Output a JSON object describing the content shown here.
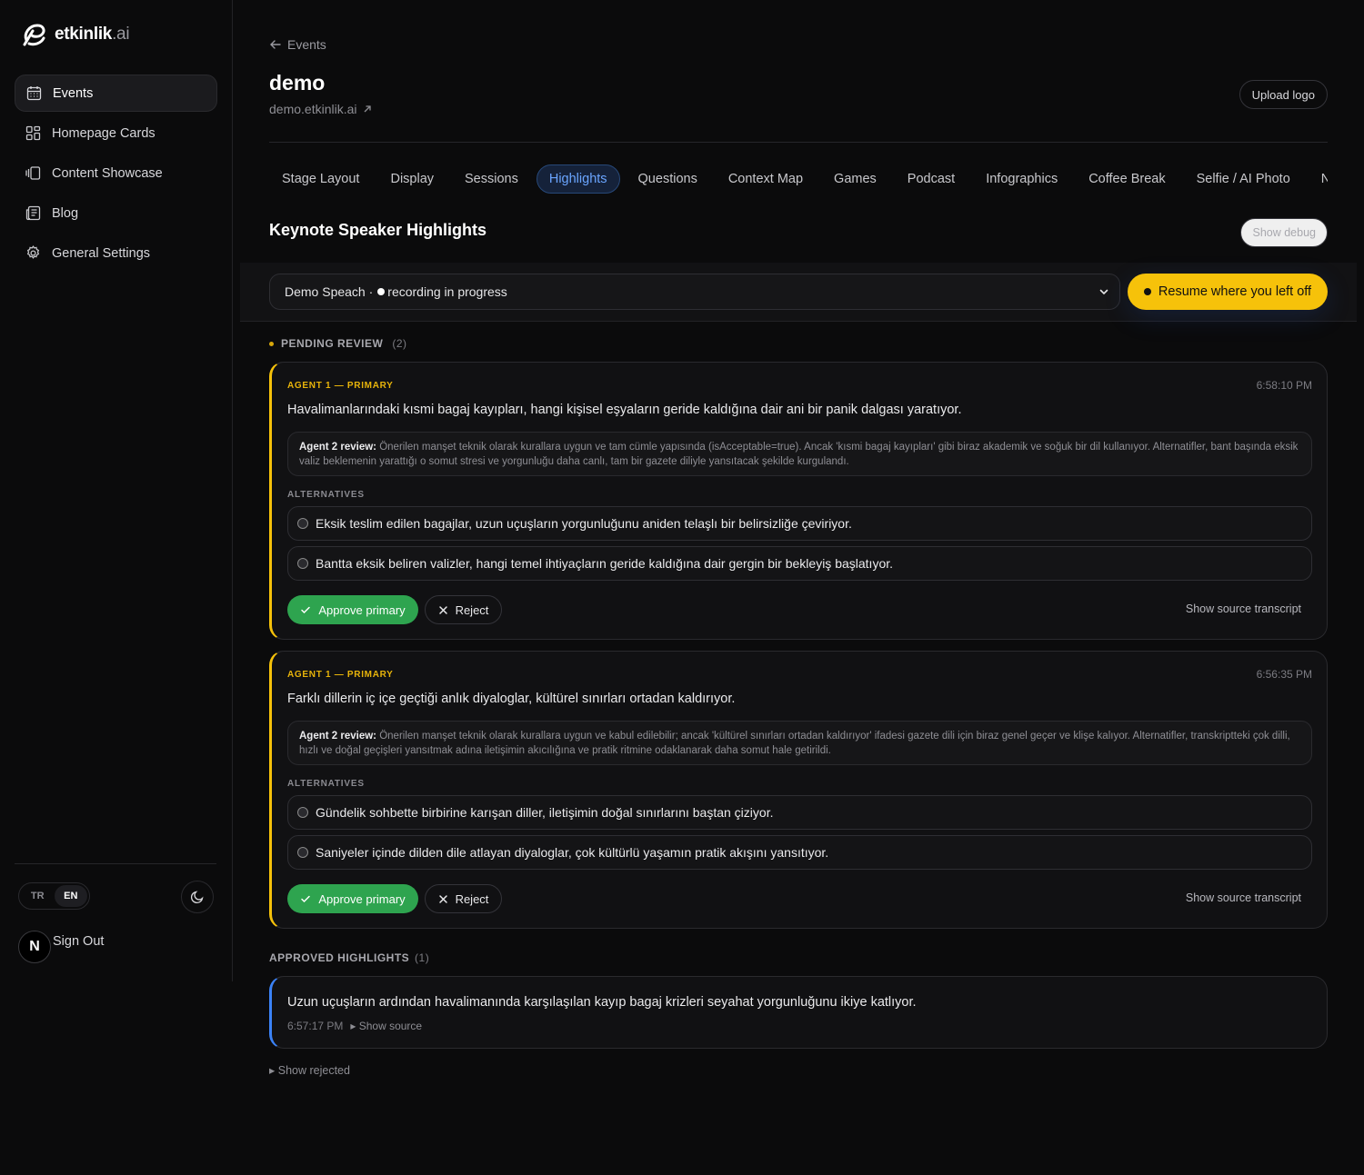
{
  "brand": {
    "name": "etkinlik",
    "suffix": ".ai"
  },
  "sidebar": {
    "items": [
      {
        "label": "Events",
        "icon": "calendar-icon",
        "active": true
      },
      {
        "label": "Homepage Cards",
        "icon": "grid-icon"
      },
      {
        "label": "Content Showcase",
        "icon": "showcase-icon"
      },
      {
        "label": "Blog",
        "icon": "newspaper-icon"
      },
      {
        "label": "General Settings",
        "icon": "gear-icon"
      }
    ],
    "lang": {
      "tr": "TR",
      "en": "EN",
      "selected": "EN"
    },
    "user_initial": "N",
    "sign_out": "Sign Out"
  },
  "header": {
    "back_label": "Events",
    "title": "demo",
    "subdomain": "demo.etkinlik.ai",
    "upload_logo": "Upload logo"
  },
  "tabs": [
    "Stage Layout",
    "Display",
    "Sessions",
    "Highlights",
    "Questions",
    "Context Map",
    "Games",
    "Podcast",
    "Infographics",
    "Coffee Break",
    "Selfie / AI Photo",
    "Ne"
  ],
  "active_tab": "Highlights",
  "section": {
    "title": "Keynote Speaker Highlights",
    "debug_btn": "Show debug"
  },
  "speech_selector": {
    "name": "Demo Speach",
    "separator": "·",
    "status": "recording in progress",
    "resume_btn": "Resume where you left off"
  },
  "pending": {
    "label": "PENDING REVIEW",
    "count": "(2)",
    "cards": [
      {
        "agent_label": "AGENT 1 — PRIMARY",
        "time": "6:58:10 PM",
        "primary": "Havalimanlarındaki kısmi bagaj kayıpları, hangi kişisel eşyaların geride kaldığına dair ani bir panik dalgası yaratıyor.",
        "review_label": "Agent 2 review:",
        "review_text": "Önerilen manşet teknik olarak kurallara uygun ve tam cümle yapısında (isAcceptable=true). Ancak 'kısmi bagaj kayıpları' gibi biraz akademik ve soğuk bir dil kullanıyor. Alternatifler, bant başında eksik valiz beklemenin yarattığı o somut stresi ve yorgunluğu daha canlı, tam bir gazete diliyle yansıtacak şekilde kurgulandı.",
        "alternatives_label": "ALTERNATIVES",
        "alternatives": [
          "Eksik teslim edilen bagajlar, uzun uçuşların yorgunluğunu aniden telaşlı bir belirsizliğe çeviriyor.",
          "Bantta eksik beliren valizler, hangi temel ihtiyaçların geride kaldığına dair gergin bir bekleyiş başlatıyor."
        ],
        "approve": "Approve primary",
        "reject": "Reject",
        "transcript": "Show source transcript"
      },
      {
        "agent_label": "AGENT 1 — PRIMARY",
        "time": "6:56:35 PM",
        "primary": "Farklı dillerin iç içe geçtiği anlık diyaloglar, kültürel sınırları ortadan kaldırıyor.",
        "review_label": "Agent 2 review:",
        "review_text": "Önerilen manşet teknik olarak kurallara uygun ve kabul edilebilir; ancak 'kültürel sınırları ortadan kaldırıyor' ifadesi gazete dili için biraz genel geçer ve klişe kalıyor. Alternatifler, transkriptteki çok dilli, hızlı ve doğal geçişleri yansıtmak adına iletişimin akıcılığına ve pratik ritmine odaklanarak daha somut hale getirildi.",
        "alternatives_label": "ALTERNATIVES",
        "alternatives": [
          "Gündelik sohbette birbirine karışan diller, iletişimin doğal sınırlarını baştan çiziyor.",
          "Saniyeler içinde dilden dile atlayan diyaloglar, çok kültürlü yaşamın pratik akışını yansıtıyor."
        ],
        "approve": "Approve primary",
        "reject": "Reject",
        "transcript": "Show source transcript"
      }
    ]
  },
  "approved": {
    "label": "APPROVED HIGHLIGHTS",
    "count": "(1)",
    "items": [
      {
        "text": "Uzun uçuşların ardından havalimanında karşılaşılan kayıp bagaj krizleri seyahat yorgunluğunu ikiye katlıyor.",
        "time": "6:57:17 PM",
        "source": "▸ Show source"
      }
    ]
  },
  "show_rejected": "▸ Show rejected",
  "colors": {
    "accent_yellow": "#f6c20a",
    "approve_green": "#2ea44f",
    "approved_blue": "#3b82f6",
    "tab_active": "#6aa5ff"
  }
}
